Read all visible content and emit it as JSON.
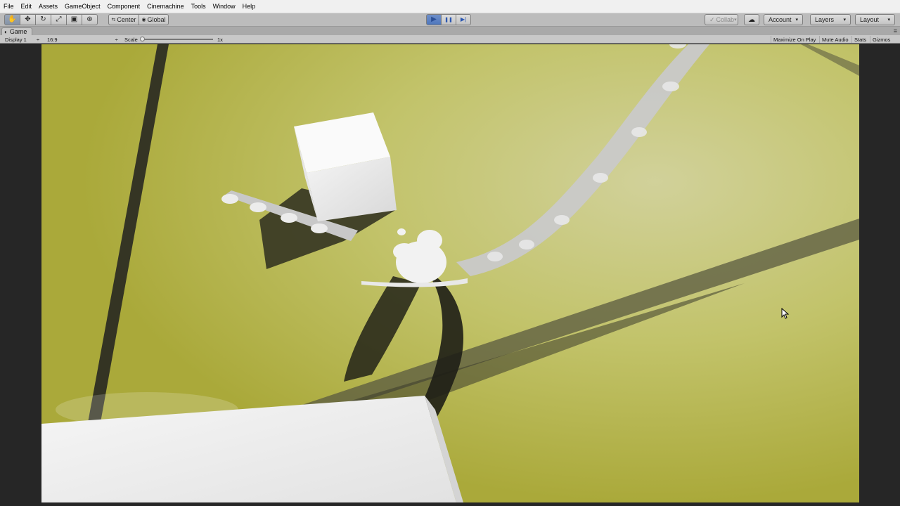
{
  "menu": [
    "File",
    "Edit",
    "Assets",
    "GameObject",
    "Component",
    "Cinemachine",
    "Tools",
    "Window",
    "Help"
  ],
  "toolbar": {
    "tools": [
      {
        "name": "hand-tool-icon",
        "glyph": "✋"
      },
      {
        "name": "move-tool-icon",
        "glyph": "✥"
      },
      {
        "name": "rotate-tool-icon",
        "glyph": "↻"
      },
      {
        "name": "scale-tool-icon",
        "glyph": "⤢"
      },
      {
        "name": "rect-tool-icon",
        "glyph": "▣"
      },
      {
        "name": "transform-tool-icon",
        "glyph": "⊛"
      }
    ],
    "pivot_label": "Center",
    "pivot_glyph": "⇆",
    "space_label": "Global",
    "space_glyph": "◉",
    "play_glyph": "▶",
    "pause_glyph": "❚❚",
    "step_glyph": "▶|",
    "collab_label": "Collab",
    "collab_check": "✓",
    "cloud_glyph": "☁",
    "account_label": "Account",
    "layers_label": "Layers",
    "layout_label": "Layout",
    "caret": "▾"
  },
  "game_tab": {
    "label": "Game",
    "icon": "◐",
    "menu_glyph": "≡"
  },
  "game_toolbar": {
    "display": "Display 1",
    "aspect": "16:9",
    "scale_label": "Scale",
    "scale_value": "1x",
    "maximize_on_play": "Maximize On Play",
    "mute_audio": "Mute Audio",
    "stats": "Stats",
    "gizmos": "Gizmos",
    "dropdown_caret": "÷"
  },
  "colors": {
    "accent_play": "#4f77bd",
    "ground": "#b8b93e",
    "menubar": "#f0f0f0",
    "toolbar": "#bcbcbc"
  }
}
